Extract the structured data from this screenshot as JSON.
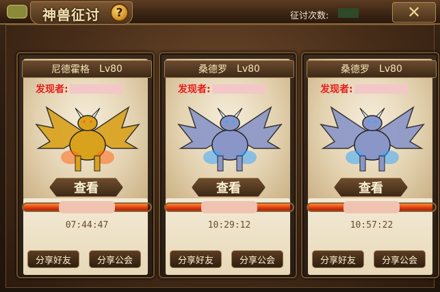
{
  "header": {
    "title": "神兽征讨",
    "help_icon": "question-icon",
    "help_label": "?",
    "count_label": "征讨次数:",
    "count_value": "",
    "close_icon": "close-x-icon",
    "close_label": "✕"
  },
  "cards": [
    {
      "name": "尼德霍格",
      "level": "Lv80",
      "finder_label": "发现者:",
      "finder_value": "",
      "beast_icon": "golden-dragon-icon",
      "beast_primary": "#d9a21c",
      "beast_secondary": "#ff6a1a",
      "view_label": "查看",
      "hp_fraction": 0.98,
      "hp_text": "",
      "timer": "07:44:47",
      "share_friend": "分享好友",
      "share_guild": "分享公会"
    },
    {
      "name": "桑德罗",
      "level": "Lv80",
      "finder_label": "发现者:",
      "finder_value": "",
      "beast_icon": "bone-dragon-icon",
      "beast_primary": "#8a96c8",
      "beast_secondary": "#3aa7ff",
      "view_label": "查看",
      "hp_fraction": 0.98,
      "hp_text": "",
      "timer": "10:29:12",
      "share_friend": "分享好友",
      "share_guild": "分享公会"
    },
    {
      "name": "桑德罗",
      "level": "Lv80",
      "finder_label": "发现者:",
      "finder_value": "",
      "beast_icon": "bone-dragon-icon",
      "beast_primary": "#8a96c8",
      "beast_secondary": "#3aa7ff",
      "view_label": "查看",
      "hp_fraction": 0.98,
      "hp_text": "",
      "timer": "10:57:22",
      "share_friend": "分享好友",
      "share_guild": "分享公会"
    }
  ]
}
